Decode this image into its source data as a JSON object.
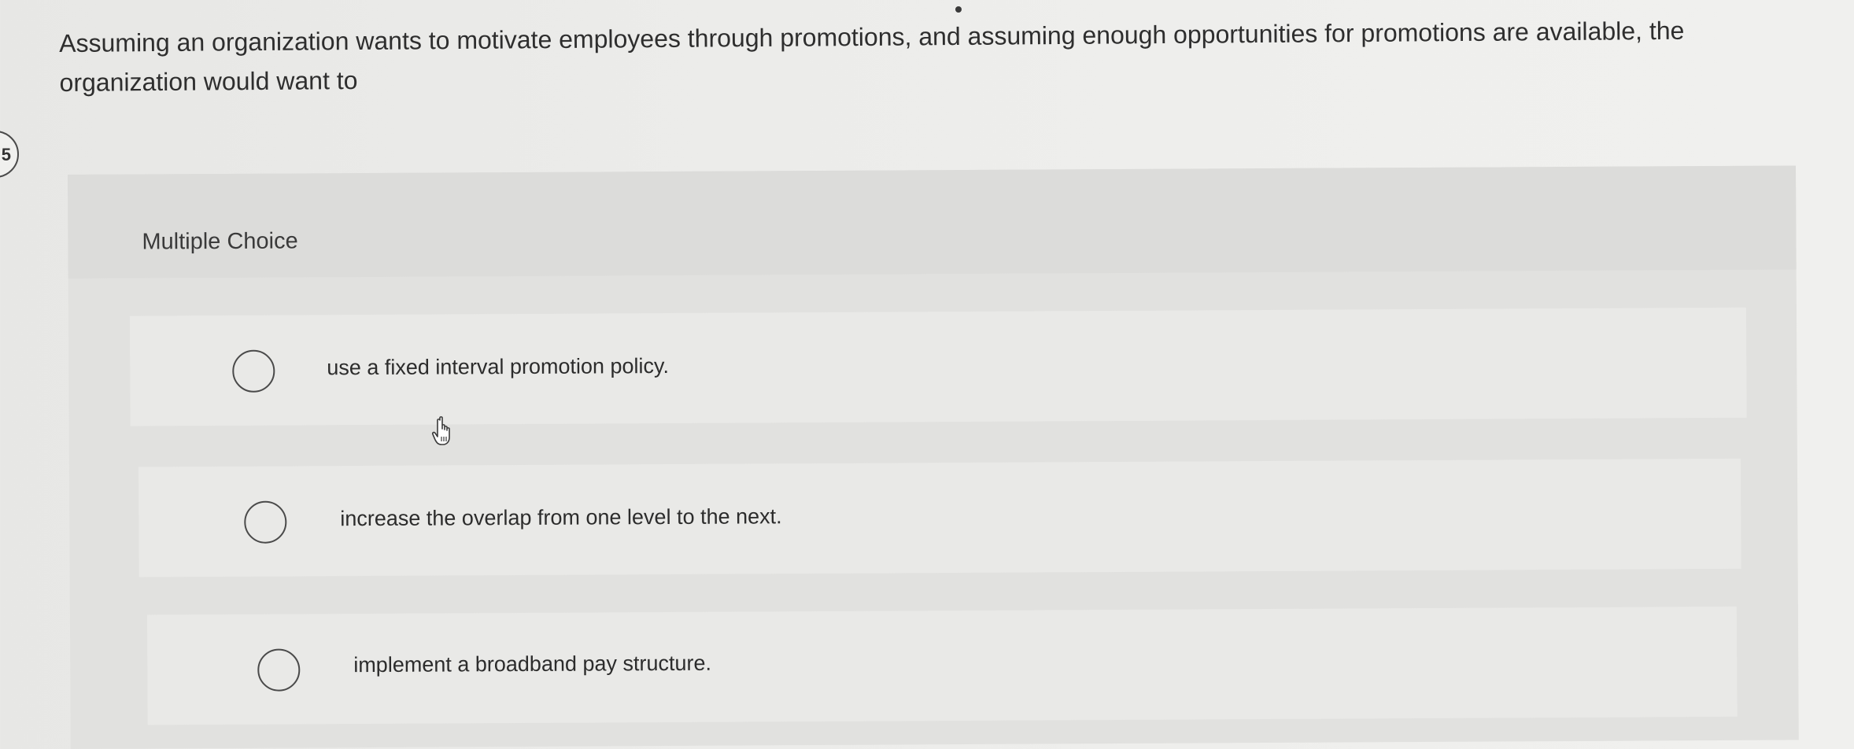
{
  "question": {
    "number": "5",
    "text": "Assuming an organization wants to motivate employees through promotions, and assuming enough opportunities for promotions are available, the organization would want to"
  },
  "choice_section": {
    "type_label": "Multiple Choice",
    "options": [
      {
        "label": "use a fixed interval promotion policy.",
        "selected": false
      },
      {
        "label": "increase the overlap from one level to the next.",
        "selected": false
      },
      {
        "label": "implement a broadband pay structure.",
        "selected": false
      }
    ]
  },
  "icons": {
    "cursor": "hand-pointer-icon",
    "radio": "radio-button-icon"
  },
  "colors": {
    "background": "#ececea",
    "panel": "#e1e1df",
    "option": "#e9e9e7",
    "text": "#2e2e2e"
  }
}
